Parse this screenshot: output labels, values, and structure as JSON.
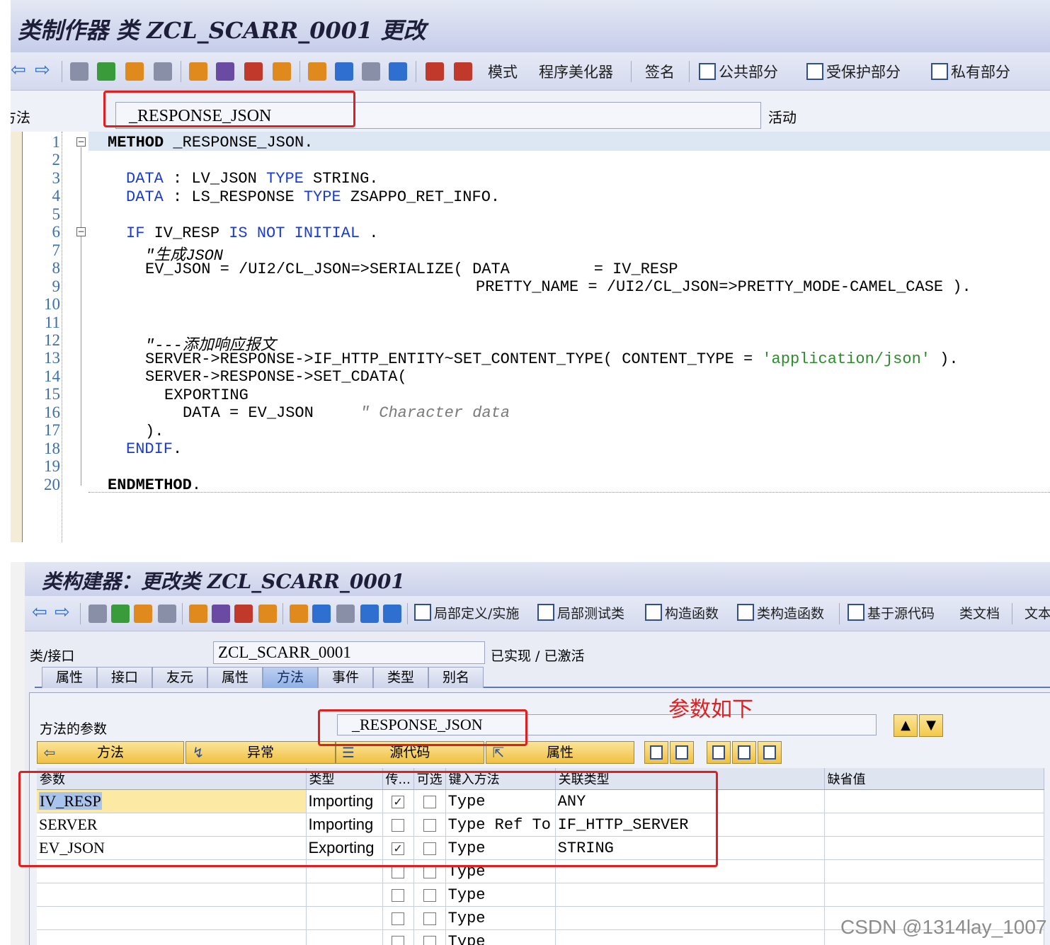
{
  "top_window": {
    "title": "类制作器 类 ZCL_SCARR_0001 更改",
    "toolbar_text": {
      "pattern": "模式",
      "pretty_printer": "程序美化器",
      "signature": "签名",
      "public_section": "公共部分",
      "protected_section": "受保护部分",
      "private_section": "私有部分"
    },
    "method_label": "方法",
    "method_name": "_RESPONSE_JSON",
    "status": "活动",
    "code_lines": [
      {
        "n": "1"
      },
      {
        "n": "2"
      },
      {
        "n": "3"
      },
      {
        "n": "4"
      },
      {
        "n": "5"
      },
      {
        "n": "6"
      },
      {
        "n": "7"
      },
      {
        "n": "8"
      },
      {
        "n": "9"
      },
      {
        "n": "10"
      },
      {
        "n": "11"
      },
      {
        "n": "12"
      },
      {
        "n": "13"
      },
      {
        "n": "14"
      },
      {
        "n": "15"
      },
      {
        "n": "16"
      },
      {
        "n": "17"
      },
      {
        "n": "18"
      },
      {
        "n": "19"
      },
      {
        "n": "20"
      }
    ],
    "code": {
      "l1": {
        "kw": "METHOD",
        "rest": " _RESPONSE_JSON."
      },
      "l3": {
        "kw1": "DATA",
        "a": " : LV_JSON ",
        "kw2": "TYPE",
        "b": " STRING."
      },
      "l4": {
        "kw1": "DATA",
        "a": " : LS_RESPONSE ",
        "kw2": "TYPE",
        "b": " ZSAPPO_RET_INFO."
      },
      "l6": {
        "kw1": "IF",
        "a": " IV_RESP ",
        "kw2": "IS NOT INITIAL",
        "b": " ."
      },
      "l7": {
        "cm": "\"生成JSON"
      },
      "l8": {
        "t": "EV_JSON = /UI2/CL_JSON=>SERIALIZE( DATA         = IV_RESP"
      },
      "l9": {
        "t": "PRETTY_NAME = /UI2/CL_JSON=>PRETTY_MODE-CAMEL_CASE )."
      },
      "l12": {
        "cm": "\"---添加响应报文"
      },
      "l13": {
        "a": "SERVER->RESPONSE->IF_HTTP_ENTITY~SET_CONTENT_TYPE( CONTENT_TYPE = ",
        "st": "'application/json'",
        "b": " )."
      },
      "l14": {
        "t": "SERVER->RESPONSE->SET_CDATA("
      },
      "l15": {
        "kw": "EXPORTING"
      },
      "l16": {
        "a": "DATA = EV_JSON     ",
        "cm": "\" Character data"
      },
      "l17": {
        "t": ")."
      },
      "l18": {
        "kw": "ENDIF",
        "rest": "."
      },
      "l20": {
        "kw": "ENDMETHOD",
        "rest": "."
      }
    }
  },
  "bottom_window": {
    "title": "类构建器：更改类 ZCL_SCARR_0001",
    "toolbar_text": {
      "local_defs": "局部定义/实施",
      "local_test": "局部测试类",
      "constructor": "构造函数",
      "class_constructor": "类构造函数",
      "source_based": "基于源代码",
      "class_doc": "类文档",
      "text": "文本"
    },
    "class_label": "类/接口",
    "class_name": "ZCL_SCARR_0001",
    "class_status": "已实现 / 已激活",
    "tabs": [
      "属性",
      "接口",
      "友元",
      "属性",
      "方法",
      "事件",
      "类型",
      "别名"
    ],
    "active_tab_index": 4,
    "method_params_label": "方法的参数",
    "method_name": "_RESPONSE_JSON",
    "annotation": "参数如下",
    "segments": {
      "method": "方法",
      "exception": "异常",
      "source": "源代码",
      "attributes": "属性"
    },
    "columns": [
      "参数",
      "类型",
      "传...",
      "可选",
      "键入方法",
      "关联类型",
      "缺省值"
    ],
    "rows": [
      {
        "param": "IV_RESP",
        "ptype": "Importing",
        "byval": true,
        "optional": false,
        "mode": "Type",
        "ref": "ANY"
      },
      {
        "param": "SERVER",
        "ptype": "Importing",
        "byval": false,
        "optional": false,
        "mode": "Type Ref To",
        "ref": "IF_HTTP_SERVER"
      },
      {
        "param": "EV_JSON",
        "ptype": "Exporting",
        "byval": true,
        "optional": false,
        "mode": "Type",
        "ref": "STRING"
      },
      {
        "param": "",
        "ptype": "",
        "byval": false,
        "optional": false,
        "mode": "Type",
        "ref": ""
      },
      {
        "param": "",
        "ptype": "",
        "byval": false,
        "optional": false,
        "mode": "Type",
        "ref": ""
      },
      {
        "param": "",
        "ptype": "",
        "byval": false,
        "optional": false,
        "mode": "Type",
        "ref": ""
      },
      {
        "param": "",
        "ptype": "",
        "byval": false,
        "optional": false,
        "mode": "Type",
        "ref": ""
      }
    ]
  },
  "watermark": "CSDN @1314lay_1007"
}
